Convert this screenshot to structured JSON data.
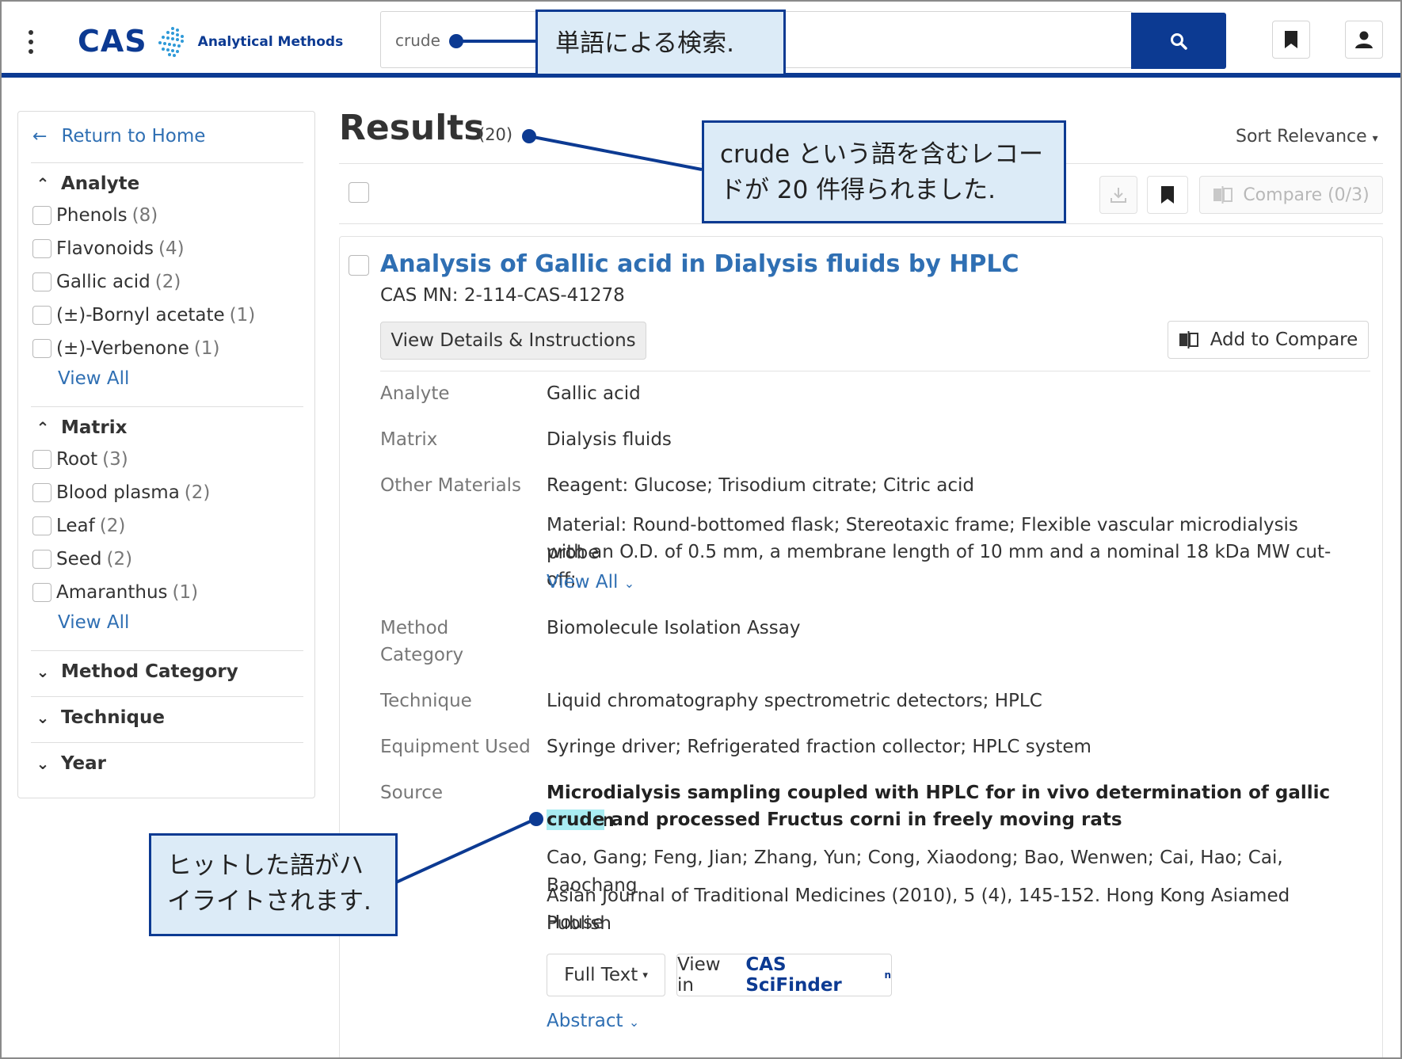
{
  "header": {
    "logo_text": "CAS",
    "logo_subtitle": "Analytical Methods",
    "search_value": "crude",
    "icons": [
      "kebab-menu-icon",
      "search-icon",
      "bookmark-icon",
      "user-icon"
    ]
  },
  "sidebar": {
    "return_home": "Return to Home",
    "facets": [
      {
        "name": "Analyte",
        "expanded": true,
        "items": [
          {
            "label": "Phenols",
            "count": "(8)"
          },
          {
            "label": "Flavonoids",
            "count": "(4)"
          },
          {
            "label": "Gallic acid",
            "count": "(2)"
          },
          {
            "label": "(±)-Bornyl acetate",
            "count": "(1)"
          },
          {
            "label": "(±)-Verbenone",
            "count": "(1)"
          }
        ],
        "view_all": "View All"
      },
      {
        "name": "Matrix",
        "expanded": true,
        "items": [
          {
            "label": "Root",
            "count": "(3)"
          },
          {
            "label": "Blood plasma",
            "count": "(2)"
          },
          {
            "label": "Leaf",
            "count": "(2)"
          },
          {
            "label": "Seed",
            "count": "(2)"
          },
          {
            "label": "Amaranthus",
            "count": "(1)"
          }
        ],
        "view_all": "View All"
      },
      {
        "name": "Method Category",
        "expanded": false
      },
      {
        "name": "Technique",
        "expanded": false
      },
      {
        "name": "Year",
        "expanded": false
      }
    ]
  },
  "results": {
    "title": "Results",
    "count": "(20)",
    "sort_label": "Sort Relevance",
    "compare_label": "Compare (0/3)"
  },
  "card": {
    "title": "Analysis of Gallic acid in Dialysis fluids by HPLC",
    "cas_mn": "CAS MN: 2-114-CAS-41278",
    "details_button": "View Details & Instructions",
    "add_compare_button": "Add to Compare",
    "fields": {
      "analyte_label": "Analyte",
      "analyte_value": "Gallic acid",
      "matrix_label": "Matrix",
      "matrix_value": "Dialysis fluids",
      "other_label": "Other Materials",
      "other_value_1": "Reagent: Glucose; Trisodium citrate; Citric acid",
      "other_value_2_line1": "Material: Round-bottomed flask; Stereotaxic frame; Flexible vascular microdialysis probe",
      "other_value_2_line2": "with an O.D. of 0.5 mm, a membrane length of 10 mm and a nominal 18 kDa MW cut-off;",
      "view_all": "View All",
      "method_label_1": "Method",
      "method_label_2": "Category",
      "method_value": "Biomolecule Isolation Assay",
      "technique_label": "Technique",
      "technique_value": "Liquid chromatography spectrometric detectors; HPLC",
      "equipment_label": "Equipment Used",
      "equipment_value": "Syringe driver; Refrigerated fraction collector; HPLC system",
      "source_label": "Source",
      "source_title_line1": "Microdialysis sampling coupled with HPLC for in vivo determination of gallic acid in",
      "source_highlight": "crude",
      "source_title_line2_rest": " and processed Fructus corni in freely moving rats",
      "authors": "Cao, Gang; Feng, Jian; Zhang, Yun; Cong, Xiaodong; Bao, Wenwen; Cai, Hao; Cai, Baochang",
      "journal_line1": "Asian Journal of Traditional Medicines (2010), 5 (4), 145-152. Hong Kong Asiamed Publish",
      "journal_line2": "House"
    },
    "full_text_button": "Full Text",
    "view_in_label": "View in",
    "scifinder_label": "CAS SciFinder",
    "scifinder_sup": "n",
    "abstract_link": "Abstract"
  },
  "callouts": {
    "search": "単語による検索.",
    "results_line1": "crude という語を含むレコー",
    "results_line2": "ドが 20 件得られました.",
    "highlight_line1": "ヒットした語がハ",
    "highlight_line2": "イライトされます."
  },
  "colors": {
    "brand_navy": "#0c3a92",
    "link_blue": "#2f6fb3",
    "callout_bg": "#dcebf7",
    "highlight": "#a9ecf2"
  }
}
